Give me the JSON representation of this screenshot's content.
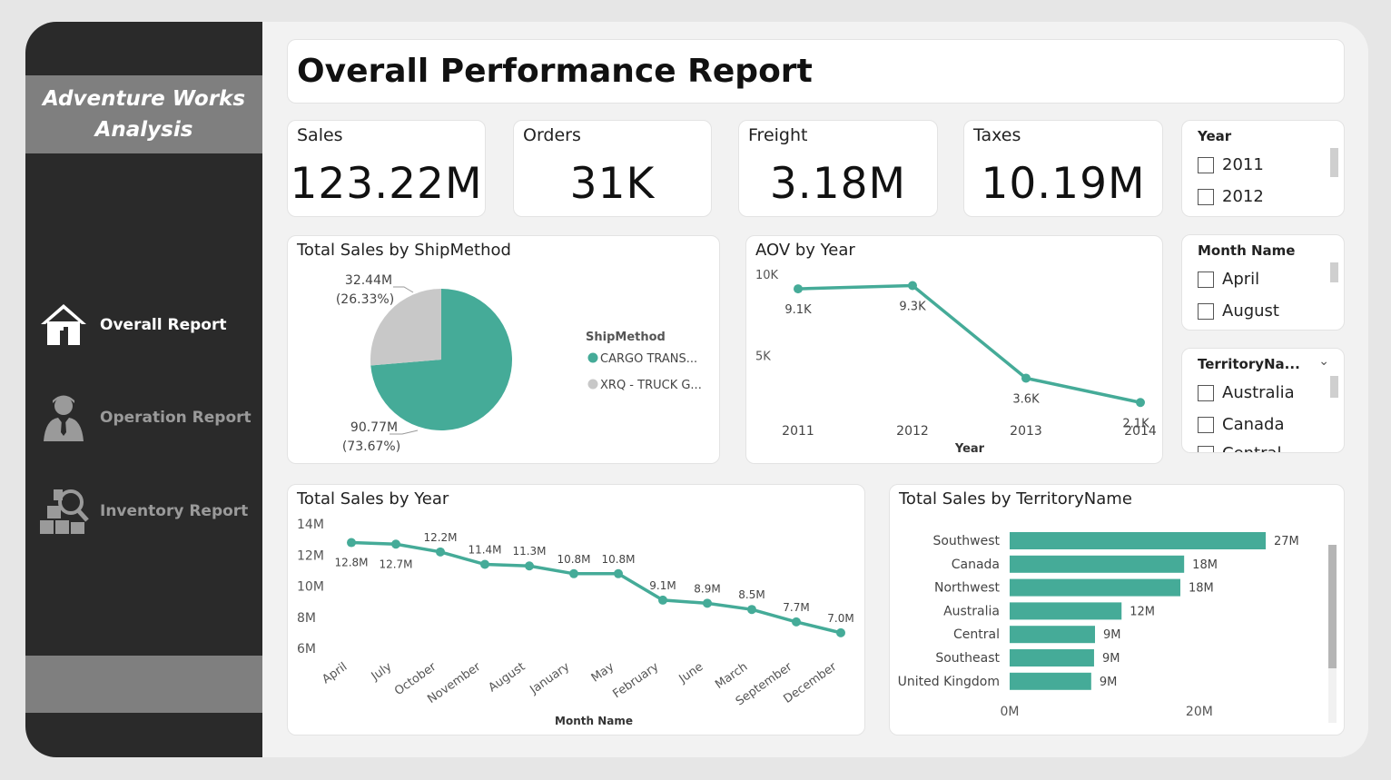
{
  "sidebar": {
    "brand": "Adventure Works\nAnalysis",
    "nav": [
      {
        "label": "Overall Report",
        "icon": "house-icon",
        "active": true
      },
      {
        "label": "Operation Report",
        "icon": "businessman-icon",
        "active": false
      },
      {
        "label": "Inventory Report",
        "icon": "inventory-search-icon",
        "active": false
      }
    ]
  },
  "header": {
    "title": "Overall Performance Report"
  },
  "kpis": [
    {
      "label": "Sales",
      "value": "123.22M"
    },
    {
      "label": "Orders",
      "value": "31K"
    },
    {
      "label": "Freight",
      "value": "3.18M"
    },
    {
      "label": "Taxes",
      "value": "10.19M"
    }
  ],
  "slicers": {
    "year": {
      "title": "Year",
      "options": [
        "2011",
        "2012"
      ]
    },
    "month": {
      "title": "Month Name",
      "options": [
        "April",
        "August"
      ]
    },
    "territory": {
      "title": "TerritoryNa...",
      "options": [
        "Australia",
        "Canada",
        "Central"
      ]
    }
  },
  "colors": {
    "accent": "#45ab98",
    "secondary": "#c8c8c8",
    "sidebar": "#2a2a2a",
    "brand_band": "#7f7f7f"
  },
  "chart_data": [
    {
      "id": "pie",
      "type": "pie",
      "title": "Total Sales by ShipMethod",
      "legend_title": "ShipMethod",
      "legend_placement": "right",
      "slices": [
        {
          "name": "CARGO TRANS...",
          "value": 90.77,
          "label": "90.77M",
          "pct": "(73.67%)",
          "color": "#45ab98"
        },
        {
          "name": "XRQ - TRUCK G...",
          "value": 32.44,
          "label": "32.44M",
          "pct": "(26.33%)",
          "color": "#c8c8c8"
        }
      ]
    },
    {
      "id": "aov",
      "type": "line",
      "title": "AOV by Year",
      "xlabel": "Year",
      "ylabel": "",
      "x": [
        "2011",
        "2012",
        "2013",
        "2014"
      ],
      "values": [
        9.1,
        9.3,
        3.6,
        2.1
      ],
      "data_labels": [
        "9.1K",
        "9.3K",
        "3.6K",
        "2.1K"
      ],
      "y_ticks": [
        {
          "v": 10,
          "label": "10K"
        },
        {
          "v": 5,
          "label": "5K"
        }
      ],
      "ylim": [
        1.5,
        10
      ]
    },
    {
      "id": "sales_year",
      "type": "line",
      "title": "Total Sales by Year",
      "xlabel": "Month Name",
      "ylabel": "",
      "x": [
        "April",
        "July",
        "October",
        "November",
        "August",
        "January",
        "May",
        "February",
        "June",
        "March",
        "September",
        "December"
      ],
      "values": [
        12.8,
        12.7,
        12.2,
        11.4,
        11.3,
        10.8,
        10.8,
        9.1,
        8.9,
        8.5,
        7.7,
        7.0
      ],
      "data_labels": [
        "12.8M",
        "12.7M",
        "12.2M",
        "11.4M",
        "11.3M",
        "10.8M",
        "10.8M",
        "9.1M",
        "8.9M",
        "8.5M",
        "7.7M",
        "7.0M"
      ],
      "y_ticks": [
        {
          "v": 14,
          "label": "14M"
        },
        {
          "v": 12,
          "label": "12M"
        },
        {
          "v": 10,
          "label": "10M"
        },
        {
          "v": 8,
          "label": "8M"
        },
        {
          "v": 6,
          "label": "6M"
        }
      ],
      "ylim": [
        6,
        14
      ]
    },
    {
      "id": "territory",
      "type": "bar",
      "orientation": "horizontal",
      "title": "Total Sales by TerritoryName",
      "categories": [
        "Southwest",
        "Canada",
        "Northwest",
        "Australia",
        "Central",
        "Southeast",
        "United Kingdom"
      ],
      "values": [
        27,
        18.4,
        18,
        11.8,
        9,
        8.9,
        8.6
      ],
      "data_labels": [
        "27M",
        "18M",
        "18M",
        "12M",
        "9M",
        "9M",
        "9M"
      ],
      "x_ticks": [
        {
          "v": 0,
          "label": "0M"
        },
        {
          "v": 20,
          "label": "20M"
        }
      ],
      "xlim": [
        0,
        30
      ]
    }
  ]
}
